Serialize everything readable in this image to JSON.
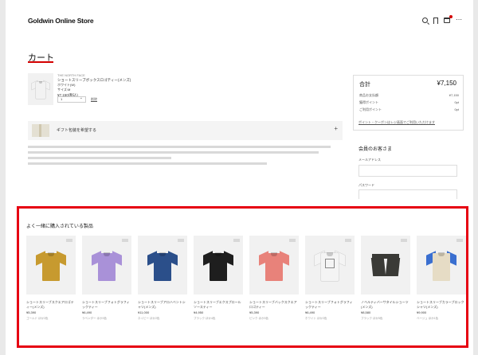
{
  "header": {
    "logo": "Goldwin Online Store",
    "icons": [
      "search-icon",
      "bookmark-icon",
      "cart-icon",
      "more-icon"
    ]
  },
  "cart": {
    "title": "カート",
    "item": {
      "brand": "THE NORTH FACE",
      "name": "ショートスリーブボックスロゴティー(メンズ)",
      "variant": "ホワイト(W)",
      "size": "サイズ:M",
      "price": "¥7,150(税込)",
      "quantity": "1",
      "delete_label": "削除",
      "thumb_color": "#f2f2f2"
    },
    "gift": {
      "label": "ギフト包装を希望する",
      "plus": "+"
    }
  },
  "summary": {
    "title": "合計",
    "total": "¥7,150",
    "rows": [
      {
        "label": "商品お支払額",
        "value": "¥7,150"
      },
      {
        "label": "獲得ポイント",
        "value": "0pt"
      },
      {
        "label": "ご利用ポイント",
        "value": "0pt"
      }
    ],
    "note": "ポイント・クーポンはレジ画面でご利用いただけます"
  },
  "login": {
    "title": "会員のお客さま",
    "email_label": "メールアドレス",
    "password_label": "パスワード"
  },
  "related": {
    "title": "よく一緒に購入されている製品",
    "products": [
      {
        "type": "tee",
        "color": "#c79a2f",
        "name": "ショートスリーブスクエアロゴティー(メンズ)",
        "price": "¥5,390",
        "sub": "ゴールド ほか2色"
      },
      {
        "type": "tee",
        "color": "#a991d8",
        "name": "ショートスリーブフォトグラフィックティー",
        "price": "¥6,490",
        "sub": "ラベンダー ほか3色"
      },
      {
        "type": "tee",
        "color": "#2b4f8a",
        "name": "ショートスリーブアロハベントシャツ(メンズ)",
        "price": "¥11,000",
        "sub": "ネイビー ほか2色"
      },
      {
        "type": "tee",
        "color": "#1e1e1e",
        "name": "ショートスリーブエクスプロールソースティー",
        "price": "¥4,950",
        "sub": "ブラック ほか4色"
      },
      {
        "type": "tee",
        "color": "#e8827a",
        "name": "ショートスリーブバックスクエアロゴティー",
        "price": "¥5,390",
        "sub": "ピンク ほか3色"
      },
      {
        "type": "tee",
        "color": "#f4f4f4",
        "name": "ショートスリーブフォトグラフィックティー",
        "price": "¥6,490",
        "sub": "ホワイト ほか2色"
      },
      {
        "type": "shorts",
        "color": "#3a3a36",
        "name": "ノベルティバーサタイルショーツ(メンズ)",
        "price": "¥8,580",
        "sub": "ブラック ほか5色"
      },
      {
        "type": "tee",
        "color": "#e6dcc5",
        "accent": "#3a6fd0",
        "name": "ショートスリーブカラーブロックシャツ(メンズ)",
        "price": "¥9,900",
        "sub": "ベージュ ほか1色"
      }
    ]
  }
}
